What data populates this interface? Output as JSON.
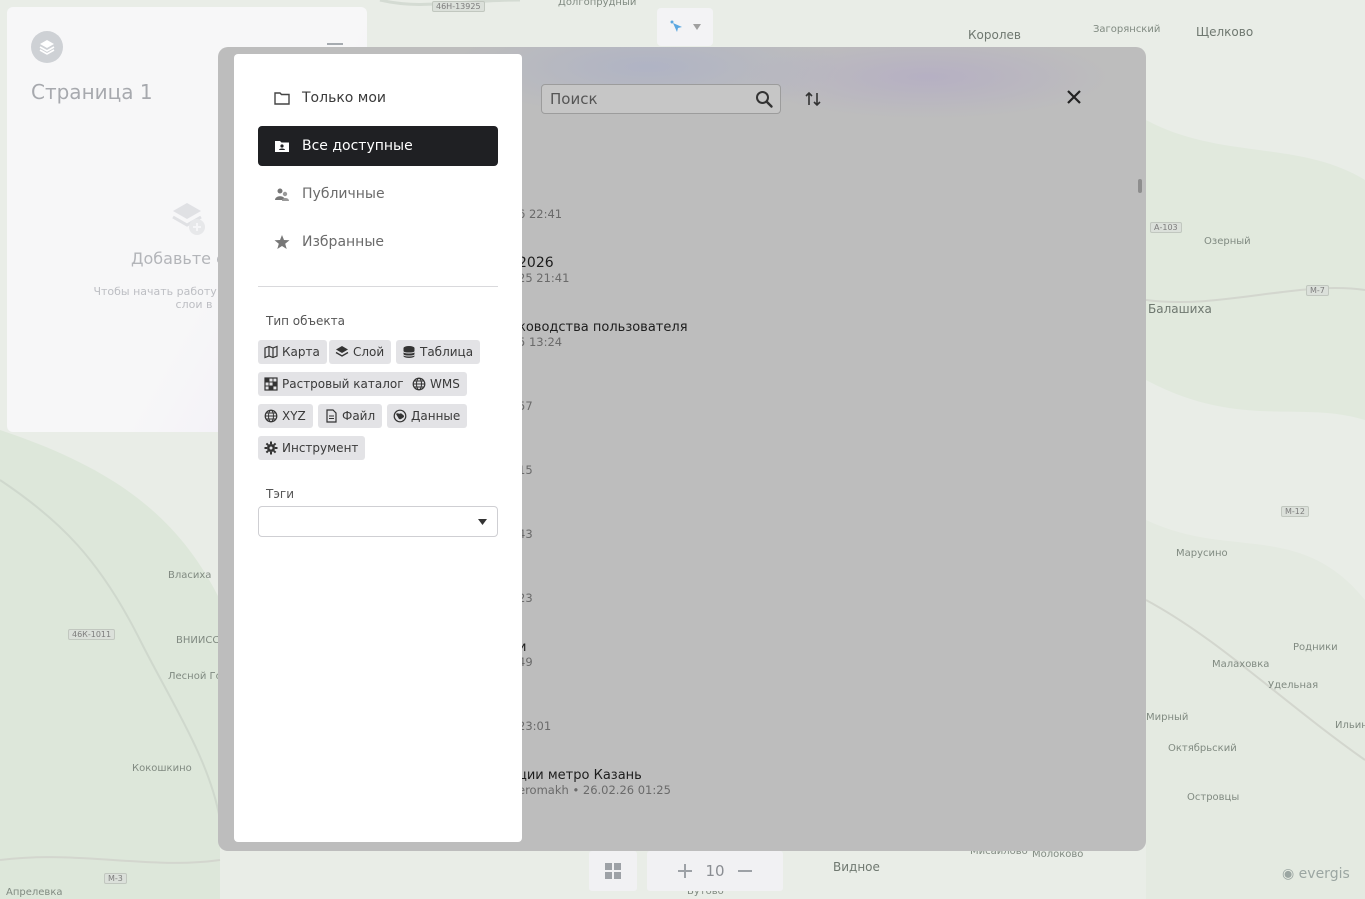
{
  "map": {
    "labels": [
      "Долгопрудный",
      "Королев",
      "Загорянский",
      "Щелково",
      "Балашиха",
      "Озерный",
      "Марусино",
      "Власиха",
      "ВНИИССОК",
      "Лесной Городок",
      "Кокошкино",
      "Апрелевка",
      "Видное",
      "Молоково",
      "Островцы",
      "Родники",
      "Малаховка",
      "Удельная",
      "Мирный",
      "Октябрьский",
      "Бутово",
      "Мисайлово",
      "Ильинский"
    ],
    "roads": [
      "46Н-13925",
      "А-103",
      "М-7",
      "М-12",
      "46К-1011",
      "М-3"
    ]
  },
  "sidebar": {
    "page_title": "Страница 1",
    "empty_title": "Добавьте сл",
    "empty_text": "Чтобы начать работу с п добавьте слои в"
  },
  "zoom": {
    "level": "10"
  },
  "brand": {
    "name": "evergis"
  },
  "modal": {
    "search_placeholder": "Поиск",
    "items": [
      {
        "name": "",
        "meta": "6 22:41"
      },
      {
        "name": "2026",
        "meta": "25 21:41"
      },
      {
        "name": "ководства пользователя",
        "meta": "5 13:24"
      },
      {
        "name": "",
        "meta": "57"
      },
      {
        "name": "",
        "meta": "15"
      },
      {
        "name": "",
        "meta": "43"
      },
      {
        "name": "",
        "meta": "23"
      },
      {
        "name": "и",
        "meta": "49"
      },
      {
        "name": "",
        "meta": "23:01"
      },
      {
        "name": "ции метро Казань",
        "meta": "eromakh • 26.02.26 01:25"
      }
    ]
  },
  "filters": {
    "nav": [
      {
        "label": "Только мои",
        "icon": "folder-icon"
      },
      {
        "label": "Все доступные",
        "icon": "shared-folder-icon"
      },
      {
        "label": "Публичные",
        "icon": "public-users-icon"
      },
      {
        "label": "Избранные",
        "icon": "star-icon"
      }
    ],
    "object_type_label": "Тип объекта",
    "object_types": [
      "Карта",
      "Слой",
      "Таблица",
      "Растровый каталог",
      "WMS",
      "XYZ",
      "Файл",
      "Данные",
      "Инструмент"
    ],
    "tags_label": "Тэги",
    "tags_value": ""
  },
  "colors": {
    "active_nav": "#1f2023",
    "chip_bg": "#e3e3e6",
    "modal_dim": "#bdbdbd"
  }
}
